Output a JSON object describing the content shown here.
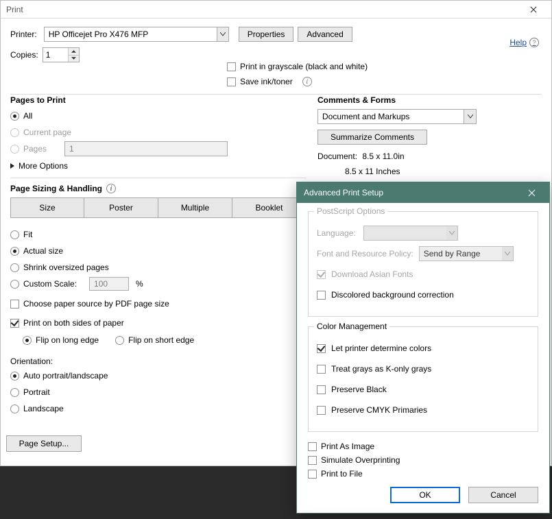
{
  "print": {
    "title": "Print",
    "printer_label": "Printer:",
    "printer_value": "HP Officejet Pro X476 MFP",
    "properties_btn": "Properties",
    "advanced_btn": "Advanced",
    "help_label": "Help",
    "copies_label": "Copies:",
    "copies_value": "1",
    "grayscale_label": "Print in grayscale (black and white)",
    "saveink_label": "Save ink/toner",
    "pages_title": "Pages to Print",
    "pages_all": "All",
    "pages_current": "Current page",
    "pages_range": "Pages",
    "pages_range_value": "1",
    "more_options": "More Options",
    "sizing_title": "Page Sizing & Handling",
    "seg_size": "Size",
    "seg_poster": "Poster",
    "seg_multiple": "Multiple",
    "seg_booklet": "Booklet",
    "fit": "Fit",
    "actual": "Actual size",
    "shrink": "Shrink oversized pages",
    "custom": "Custom Scale:",
    "custom_value": "100",
    "pct": "%",
    "choose_paper": "Choose paper source by PDF page size",
    "both_sides": "Print on both sides of paper",
    "flip_long": "Flip on long edge",
    "flip_short": "Flip on short edge",
    "orientation_title": "Orientation:",
    "orient_auto": "Auto portrait/landscape",
    "orient_portrait": "Portrait",
    "orient_landscape": "Landscape",
    "comments_title": "Comments & Forms",
    "comments_value": "Document and Markups",
    "summarize_btn": "Summarize Comments",
    "doc_label": "Document:",
    "doc_value": "8.5 x 11.0in",
    "doc_sub": "8.5 x 11 Inches",
    "page_setup_btn": "Page Setup..."
  },
  "adv": {
    "title": "Advanced Print Setup",
    "ps_title": "PostScript Options",
    "ps_lang_label": "Language:",
    "ps_lang_value": "",
    "ps_font_label": "Font and Resource Policy:",
    "ps_font_value": "Send by Range",
    "ps_download": "Download Asian Fonts",
    "ps_discolored": "Discolored background correction",
    "cm_title": "Color Management",
    "cm_let": "Let printer determine colors",
    "cm_gray": "Treat grays as K-only grays",
    "cm_black": "Preserve Black",
    "cm_cmyk": "Preserve CMYK Primaries",
    "print_image": "Print As Image",
    "simulate": "Simulate Overprinting",
    "print_file": "Print to File",
    "ok_btn": "OK",
    "cancel_btn": "Cancel"
  }
}
